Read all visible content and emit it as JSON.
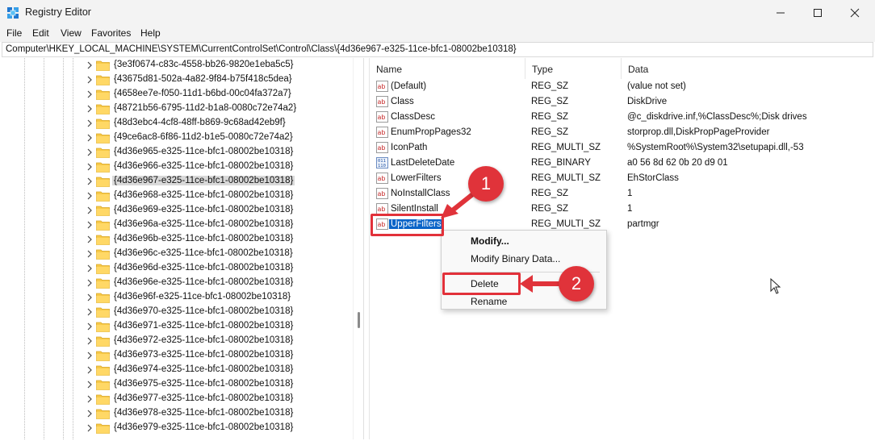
{
  "window": {
    "title": "Registry Editor"
  },
  "menu": [
    "File",
    "Edit",
    "View",
    "Favorites",
    "Help"
  ],
  "address": "Computer\\HKEY_LOCAL_MACHINE\\SYSTEM\\CurrentControlSet\\Control\\Class\\{4d36e967-e325-11ce-bfc1-08002be10318}",
  "tree": {
    "items": [
      {
        "label": "{3e3f0674-c83c-4558-bb26-9820e1eba5c5}"
      },
      {
        "label": "{43675d81-502a-4a82-9f84-b75f418c5dea}"
      },
      {
        "label": "{4658ee7e-f050-11d1-b6bd-00c04fa372a7}"
      },
      {
        "label": "{48721b56-6795-11d2-b1a8-0080c72e74a2}"
      },
      {
        "label": "{48d3ebc4-4cf8-48ff-b869-9c68ad42eb9f}"
      },
      {
        "label": "{49ce6ac8-6f86-11d2-b1e5-0080c72e74a2}"
      },
      {
        "label": "{4d36e965-e325-11ce-bfc1-08002be10318}"
      },
      {
        "label": "{4d36e966-e325-11ce-bfc1-08002be10318}"
      },
      {
        "label": "{4d36e967-e325-11ce-bfc1-08002be10318}",
        "selected": true
      },
      {
        "label": "{4d36e968-e325-11ce-bfc1-08002be10318}"
      },
      {
        "label": "{4d36e969-e325-11ce-bfc1-08002be10318}"
      },
      {
        "label": "{4d36e96a-e325-11ce-bfc1-08002be10318}"
      },
      {
        "label": "{4d36e96b-e325-11ce-bfc1-08002be10318}"
      },
      {
        "label": "{4d36e96c-e325-11ce-bfc1-08002be10318}"
      },
      {
        "label": "{4d36e96d-e325-11ce-bfc1-08002be10318}"
      },
      {
        "label": "{4d36e96e-e325-11ce-bfc1-08002be10318}"
      },
      {
        "label": "{4d36e96f-e325-11ce-bfc1-08002be10318}"
      },
      {
        "label": "{4d36e970-e325-11ce-bfc1-08002be10318}"
      },
      {
        "label": "{4d36e971-e325-11ce-bfc1-08002be10318}"
      },
      {
        "label": "{4d36e972-e325-11ce-bfc1-08002be10318}"
      },
      {
        "label": "{4d36e973-e325-11ce-bfc1-08002be10318}"
      },
      {
        "label": "{4d36e974-e325-11ce-bfc1-08002be10318}"
      },
      {
        "label": "{4d36e975-e325-11ce-bfc1-08002be10318}"
      },
      {
        "label": "{4d36e977-e325-11ce-bfc1-08002be10318}"
      },
      {
        "label": "{4d36e978-e325-11ce-bfc1-08002be10318}"
      },
      {
        "label": "{4d36e979-e325-11ce-bfc1-08002be10318}"
      }
    ]
  },
  "columns": {
    "name": "Name",
    "type": "Type",
    "data": "Data"
  },
  "values": [
    {
      "name": "(Default)",
      "type": "REG_SZ",
      "data": "(value not set)",
      "icon": "string-value-icon"
    },
    {
      "name": "Class",
      "type": "REG_SZ",
      "data": "DiskDrive",
      "icon": "string-value-icon"
    },
    {
      "name": "ClassDesc",
      "type": "REG_SZ",
      "data": "@c_diskdrive.inf,%ClassDesc%;Disk drives",
      "icon": "string-value-icon"
    },
    {
      "name": "EnumPropPages32",
      "type": "REG_SZ",
      "data": "storprop.dll,DiskPropPageProvider",
      "icon": "string-value-icon"
    },
    {
      "name": "IconPath",
      "type": "REG_MULTI_SZ",
      "data": "%SystemRoot%\\System32\\setupapi.dll,-53",
      "icon": "string-value-icon"
    },
    {
      "name": "LastDeleteDate",
      "type": "REG_BINARY",
      "data": "a0 56 8d 62 0b 20 d9 01",
      "icon": "binary-value-icon"
    },
    {
      "name": "LowerFilters",
      "type": "REG_MULTI_SZ",
      "data": "EhStorClass",
      "icon": "string-value-icon"
    },
    {
      "name": "NoInstallClass",
      "type": "REG_SZ",
      "data": "1",
      "icon": "string-value-icon"
    },
    {
      "name": "SilentInstall",
      "type": "REG_SZ",
      "data": "1",
      "icon": "string-value-icon"
    },
    {
      "name": "UpperFilters",
      "type": "REG_MULTI_SZ",
      "data": "partmgr",
      "icon": "string-value-icon",
      "selected": true
    }
  ],
  "context_menu": {
    "items": [
      {
        "label": "Modify...",
        "bold": true
      },
      {
        "label": "Modify Binary Data..."
      },
      {
        "label": "Delete"
      },
      {
        "label": "Rename"
      }
    ]
  },
  "annotations": {
    "step1": "1",
    "step2": "2",
    "accent": "#e2313a"
  }
}
